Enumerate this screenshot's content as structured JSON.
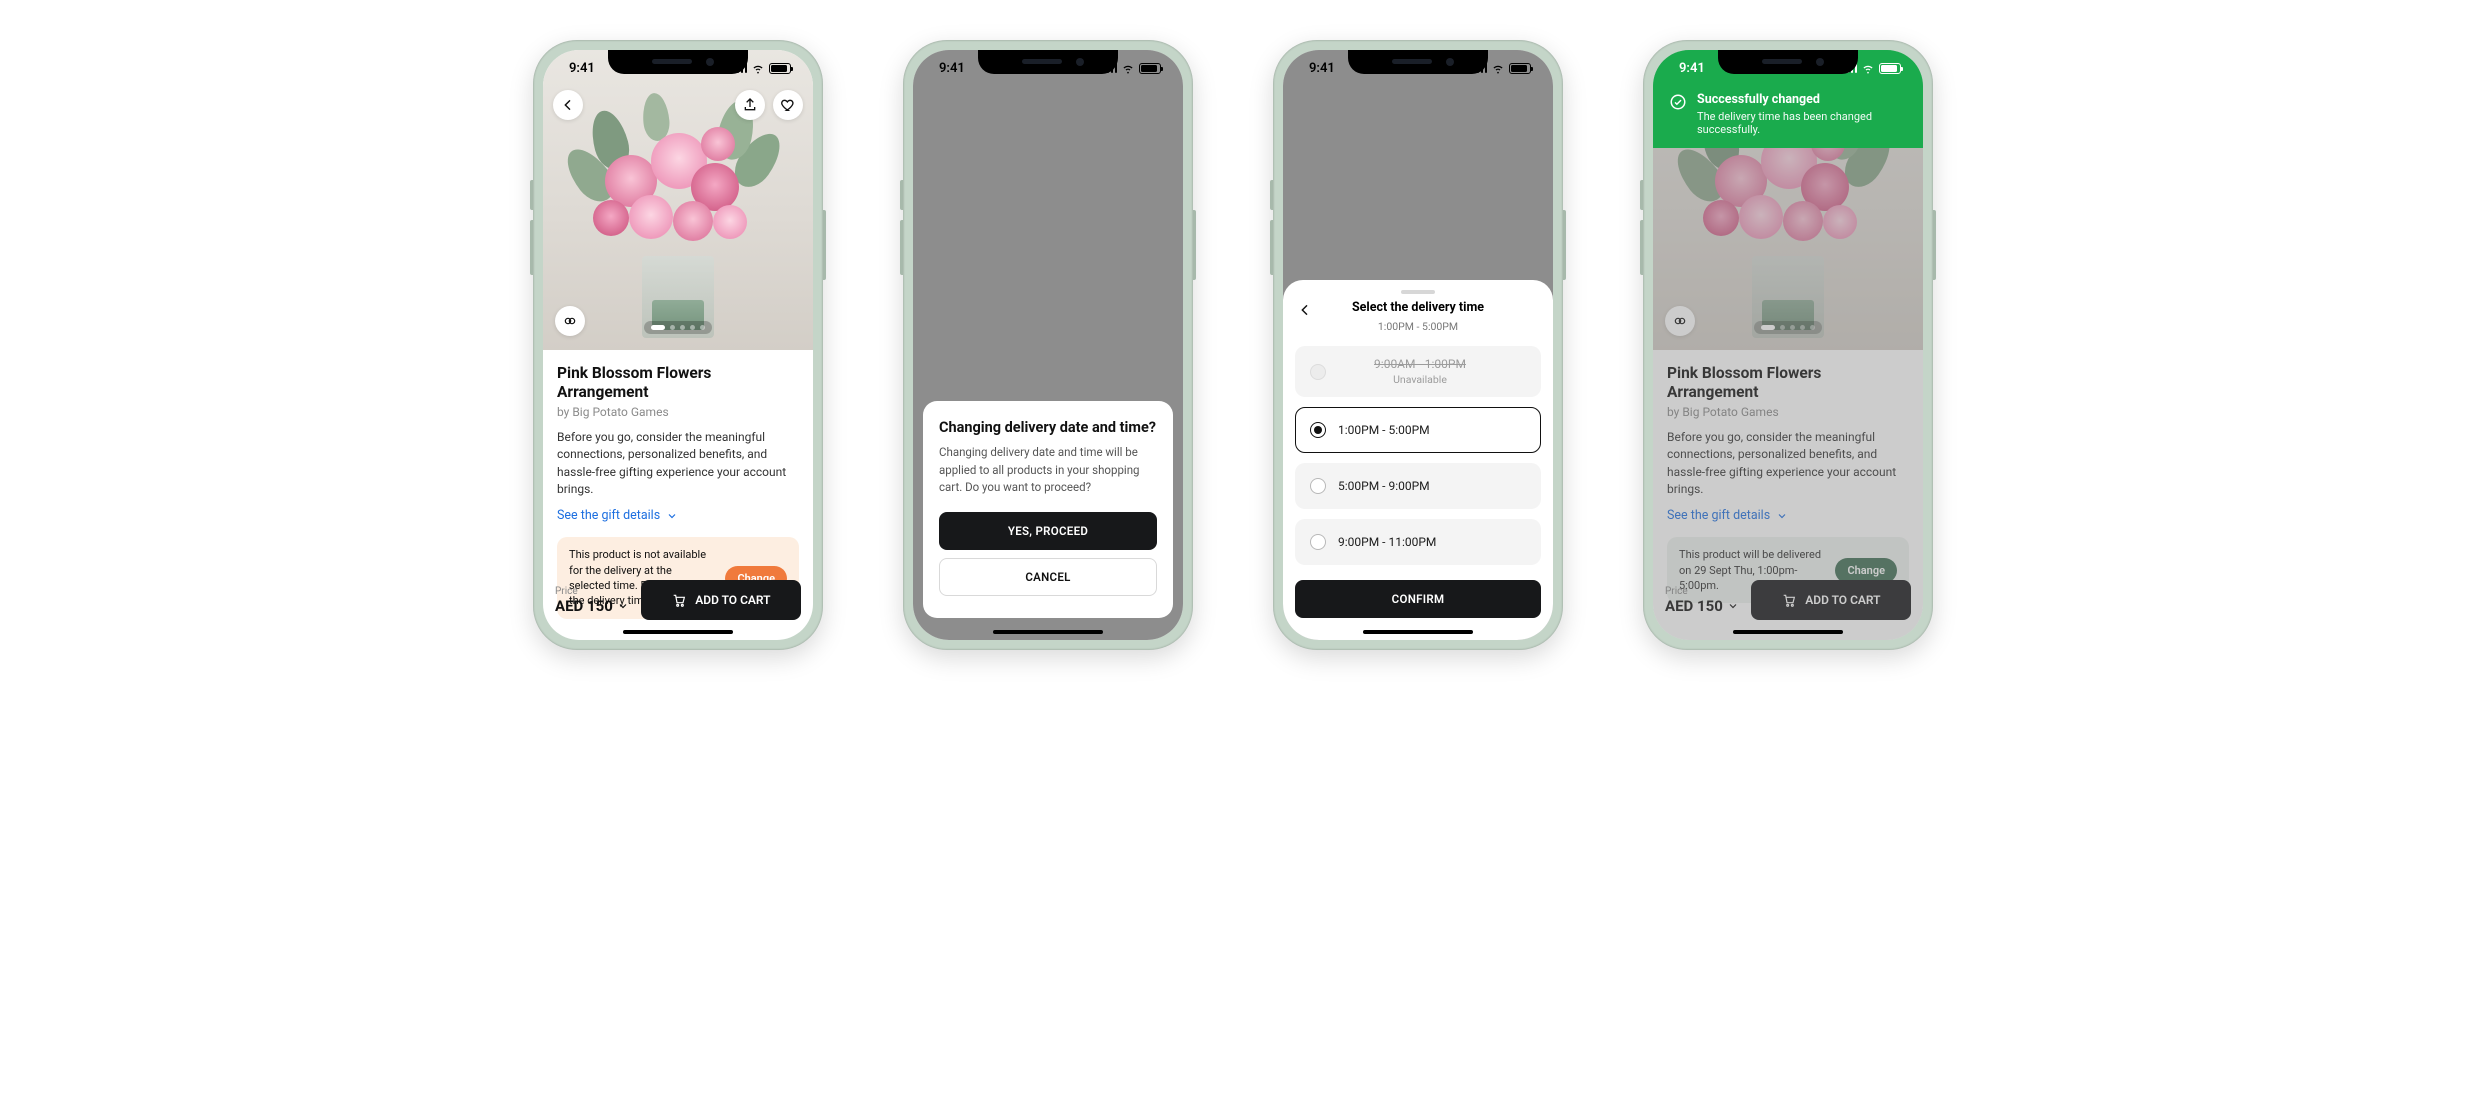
{
  "status_time": "9:41",
  "product": {
    "title": "Pink Blossom Flowers Arrangement",
    "brand": "by Big Potato Games",
    "desc": "Before you go, consider the meaningful connections, personalized benefits, and hassle-free gifting experience your account brings.",
    "details_link": "See the gift details"
  },
  "price": {
    "label": "Price",
    "value": "AED 150"
  },
  "add_to_cart": "ADD TO CART",
  "notice_warn": {
    "text": "This product is not available for the delivery at the selected time. Please change the delivery time.",
    "action": "Change"
  },
  "notice_ok": {
    "text": "This product will be delivered on 29 Sept Thu, 1:00pm-5:00pm.",
    "action": "Change"
  },
  "dialog": {
    "title": "Changing delivery date and time?",
    "body": "Changing delivery date and time will be applied to all products in your shopping cart. Do you want to proceed?",
    "yes": "YES, PROCEED",
    "cancel": "CANCEL"
  },
  "sheet": {
    "title": "Select the delivery time",
    "current": "1:00PM - 5:00PM",
    "unavailable_label": "Unavailable",
    "confirm": "CONFIRM",
    "options": {
      "o0": "9:00AM - 1:00PM",
      "o1": "1:00PM - 5:00PM",
      "o2": "5:00PM - 9:00PM",
      "o3": "9:00PM - 11:00PM"
    }
  },
  "toast": {
    "title": "Successfully changed",
    "body": "The delivery time has been changed successfully."
  }
}
